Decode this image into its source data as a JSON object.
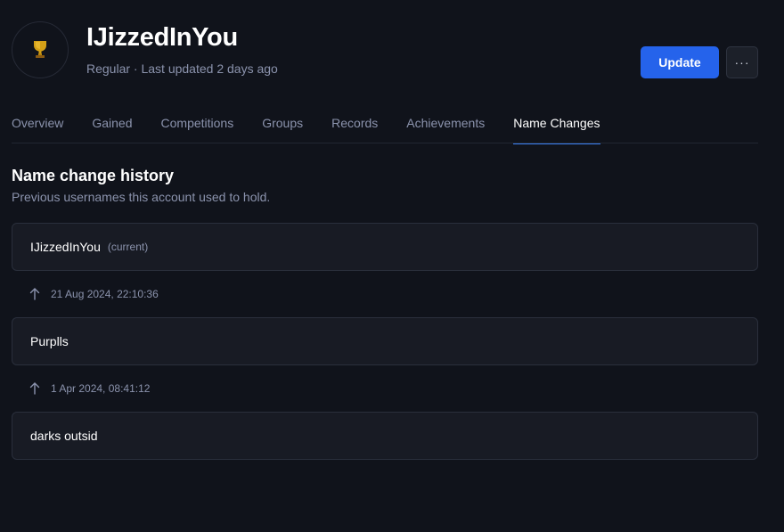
{
  "header": {
    "player_name": "IJizzedInYou",
    "meta": "Regular · Last updated 2 days ago",
    "avatar_icon": "trophy-icon",
    "update_label": "Update",
    "more_label": "···"
  },
  "colors": {
    "accent": "#2563eb",
    "tab_active_underline": "#3b82f6",
    "trophy_gold": "#d4a017",
    "background": "#10131b",
    "card_background": "#181b24"
  },
  "tabs": [
    {
      "label": "Overview",
      "active": false
    },
    {
      "label": "Gained",
      "active": false
    },
    {
      "label": "Competitions",
      "active": false
    },
    {
      "label": "Groups",
      "active": false
    },
    {
      "label": "Records",
      "active": false
    },
    {
      "label": "Achievements",
      "active": false
    },
    {
      "label": "Name Changes",
      "active": true
    }
  ],
  "section": {
    "title": "Name change history",
    "subtitle": "Previous usernames this account used to hold."
  },
  "history": {
    "names": [
      {
        "username": "IJizzedInYou",
        "tag": "(current)"
      },
      {
        "username": "Purplls",
        "tag": ""
      },
      {
        "username": "darks outsid",
        "tag": ""
      }
    ],
    "changes": [
      {
        "icon": "arrow-up-icon",
        "date": "21 Aug 2024, 22:10:36"
      },
      {
        "icon": "arrow-up-icon",
        "date": "1 Apr 2024, 08:41:12"
      }
    ]
  }
}
